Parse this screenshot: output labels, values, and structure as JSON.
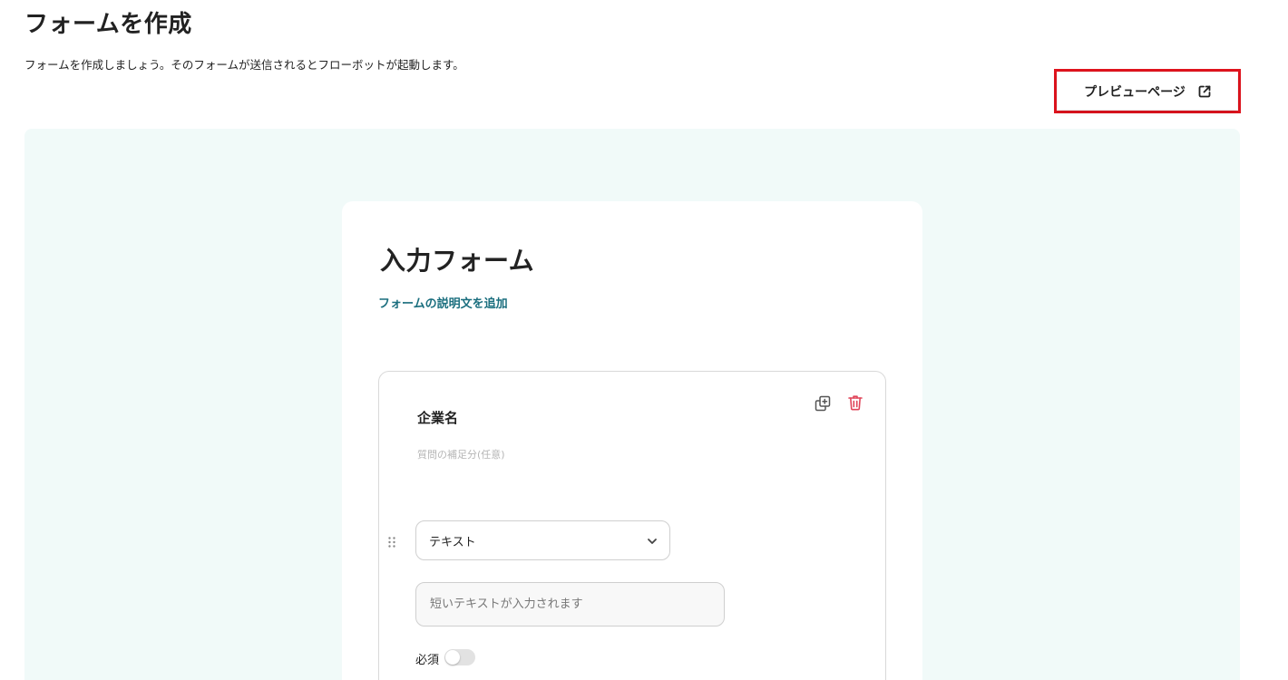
{
  "header": {
    "title": "フォームを作成",
    "description": "フォームを作成しましょう。そのフォームが送信されるとフローボットが起動します。",
    "preview_button_label": "プレビューページ",
    "preview_icon": "external-link-icon"
  },
  "form": {
    "title": "入力フォーム",
    "add_description_label": "フォームの説明文を追加",
    "question": {
      "title": "企業名",
      "sub_placeholder": "質問の補足分(任意)",
      "type_selected": "テキスト",
      "answer_placeholder": "短いテキストが入力されます",
      "required_label": "必須",
      "required_enabled": false,
      "icons": [
        "copy-icon",
        "trash-icon",
        "drag-handle-icon",
        "chevron-down-icon"
      ]
    }
  },
  "colors": {
    "canvas_background": "#f1faf9",
    "link": "#1a6e7e",
    "delete": "#e0455a",
    "highlight": "#e0141e"
  }
}
